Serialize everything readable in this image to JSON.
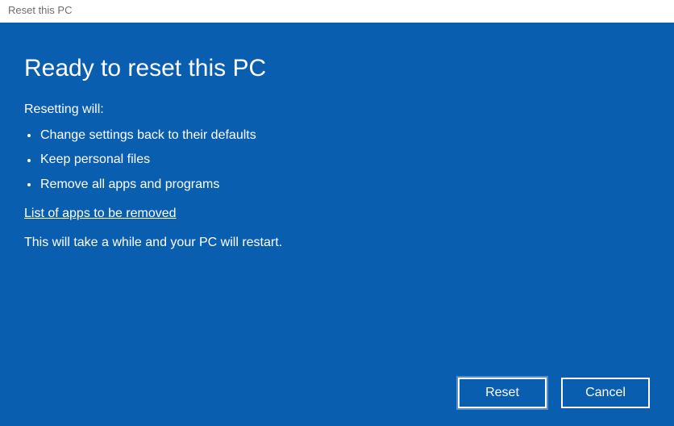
{
  "window": {
    "title": "Reset this PC"
  },
  "main": {
    "heading": "Ready to reset this PC",
    "intro": "Resetting will:",
    "bullets": [
      "Change settings back to their defaults",
      "Keep personal files",
      "Remove all apps and programs"
    ],
    "link_label": "List of apps to be removed",
    "note": "This will take a while and your PC will restart."
  },
  "buttons": {
    "reset": "Reset",
    "cancel": "Cancel"
  }
}
